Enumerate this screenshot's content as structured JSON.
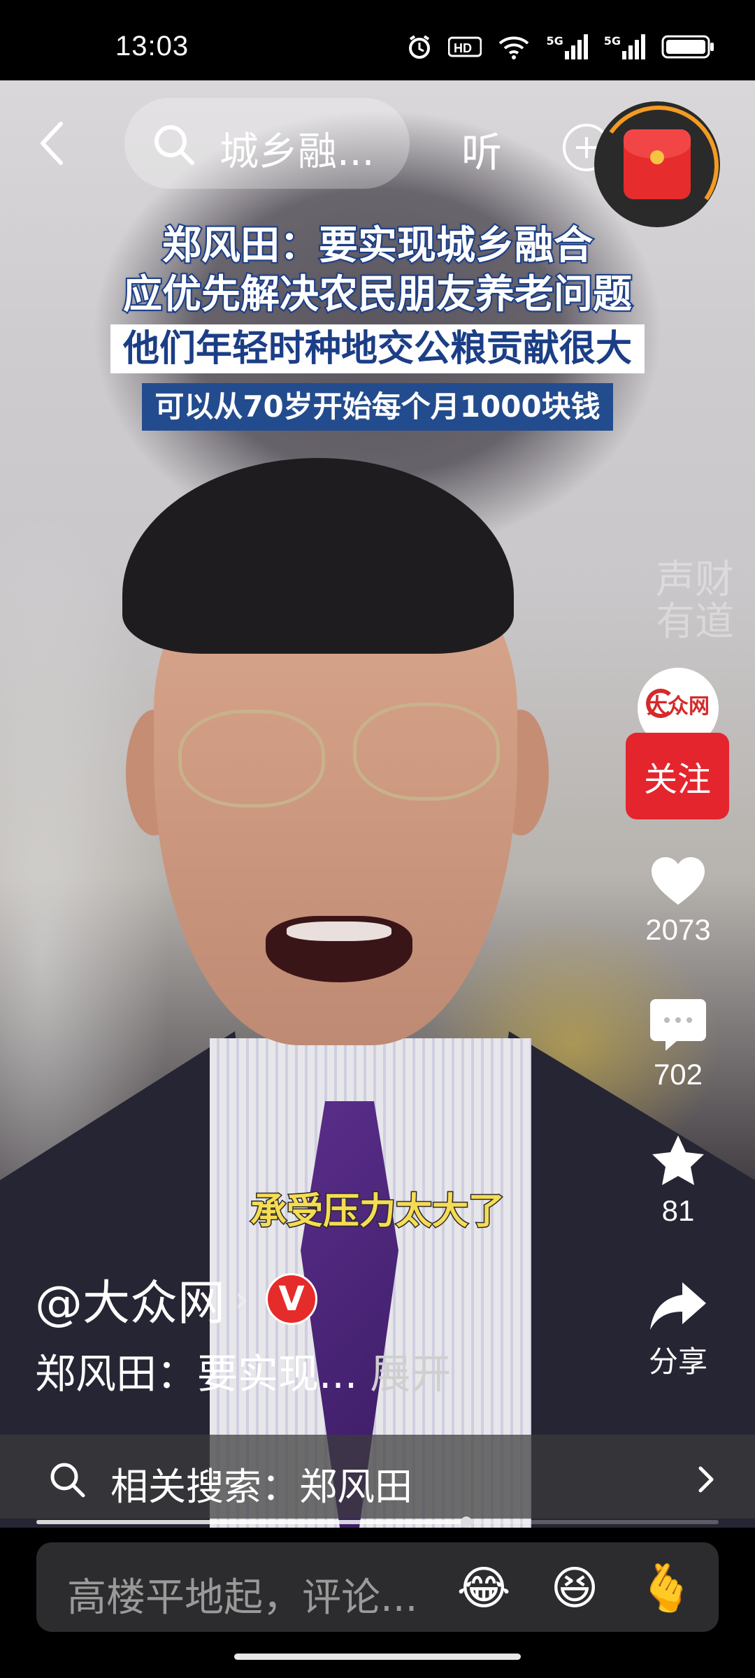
{
  "status_bar": {
    "time": "13:03",
    "hd_label": "HD",
    "sim1_label": "5G",
    "sim2_label": "5G"
  },
  "top_bar": {
    "search_text": "城乡融...",
    "listen_label": "听"
  },
  "video": {
    "headline_lines": [
      "郑风田：要实现城乡融合",
      "应优先解决农民朋友养老问题",
      "他们年轻时种地交公粮贡献很大",
      "可以从70岁开始每个月1000块钱"
    ],
    "subtitle": "承受压力太大了",
    "watermark_lines": [
      "声财",
      "有道"
    ],
    "avatar_text": "大众网"
  },
  "side_actions": {
    "follow_label": "关注",
    "likes": "2073",
    "comments": "702",
    "favorites": "81",
    "share_label": "分享"
  },
  "author": {
    "name": "@大众网"
  },
  "description": {
    "text": "郑风田：要实现...",
    "expand_label": "展开"
  },
  "related_search": {
    "label": "相关搜索：郑风田"
  },
  "progress": {
    "played_fraction": 0.63
  },
  "comment_bar": {
    "placeholder": "高楼平地起，评论...",
    "emojis": [
      "😂",
      "😆",
      "🫰"
    ]
  },
  "colors": {
    "follow": "#e5252d",
    "headline_blue": "#1b3e86",
    "subtitle_yellow": "#f6dc54",
    "badge_red": "#e62b2b"
  }
}
